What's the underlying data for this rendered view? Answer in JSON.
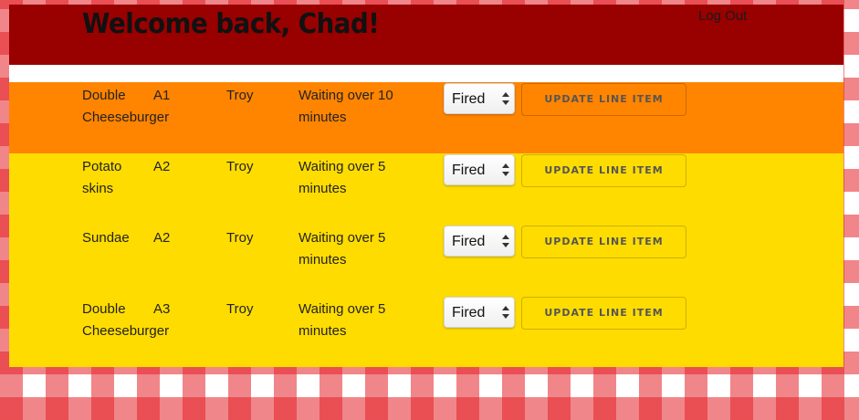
{
  "header": {
    "title": "Welcome back, Chad!",
    "logout_label": "Log Out",
    "background_color": "#990000"
  },
  "colors": {
    "urgent_row": "#FF8400",
    "warning_row": "#FFDC00"
  },
  "line_items": [
    {
      "item": "Double Cheeseburger",
      "table": "A1",
      "server": "Troy",
      "status": "Waiting over 10 minutes",
      "state": "Fired",
      "row_color": "#FF8400",
      "button_label": "UPDATE LINE ITEM"
    },
    {
      "item": "Potato skins",
      "table": "A2",
      "server": "Troy",
      "status": "Waiting over 5 minutes",
      "state": "Fired",
      "row_color": "#FFDC00",
      "button_label": "UPDATE LINE ITEM"
    },
    {
      "item": "Sundae",
      "table": "A2",
      "server": "Troy",
      "status": "Waiting over 5 minutes",
      "state": "Fired",
      "row_color": "#FFDC00",
      "button_label": "UPDATE LINE ITEM"
    },
    {
      "item": "Double Cheeseburger",
      "table": "A3",
      "server": "Troy",
      "status": "Waiting over 5 minutes",
      "state": "Fired",
      "row_color": "#FFDC00",
      "button_label": "UPDATE LINE ITEM"
    }
  ]
}
